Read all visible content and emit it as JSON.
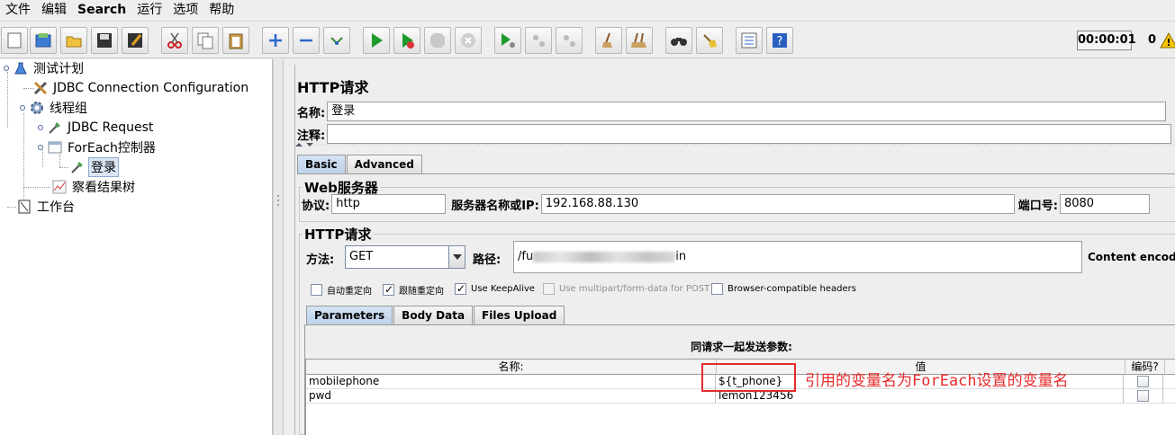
{
  "menu": [
    "文件",
    "编辑",
    "Search",
    "运行",
    "选项",
    "帮助"
  ],
  "toolbar": {
    "icons": [
      "new-icon",
      "templates-icon",
      "open-icon",
      "save-icon",
      "save-as-icon",
      "cut-icon",
      "copy-icon",
      "paste-icon",
      "expand-icon",
      "collapse-icon",
      "toggle-icon",
      "start-icon",
      "start-no-pause-icon",
      "stop-icon",
      "shutdown-icon",
      "remote-start-icon",
      "remote-stop-icon",
      "remote-shutdown-icon",
      "clear-icon",
      "clear-all-icon",
      "search-icon",
      "reset-search-icon",
      "function-helper-icon",
      "help-icon"
    ],
    "timer": "00:00:01",
    "error_count": "0"
  },
  "tree": {
    "items": [
      {
        "label": "测试计划"
      },
      {
        "label": "JDBC Connection Configuration"
      },
      {
        "label": "线程组"
      },
      {
        "label": "JDBC Request"
      },
      {
        "label": "ForEach控制器"
      },
      {
        "label": "登录"
      },
      {
        "label": "察看结果树"
      },
      {
        "label": "工作台"
      }
    ]
  },
  "panel": {
    "title": "HTTP请求",
    "name_label": "名称:",
    "name_value": "登录",
    "comment_label": "注释:",
    "comment_value": "",
    "tabs": [
      "Basic",
      "Advanced"
    ],
    "web_server": {
      "title": "Web服务器",
      "protocol_label": "协议:",
      "protocol": "http",
      "server_label": "服务器名称或IP:",
      "server": "192.168.88.130",
      "port_label": "端口号:",
      "port": "8080"
    },
    "http_request": {
      "title": "HTTP请求",
      "method_label": "方法:",
      "method": "GET",
      "path_label": "路径:",
      "path_prefix": "/fu",
      "path_suffix": "in",
      "content_encoding_label": "Content encoding"
    },
    "options": [
      {
        "label": "自动重定向",
        "checked": false,
        "disabled": false
      },
      {
        "label": "跟随重定向",
        "checked": true,
        "disabled": false
      },
      {
        "label": "Use KeepAlive",
        "checked": true,
        "disabled": false
      },
      {
        "label": "Use multipart/form-data for POST",
        "checked": false,
        "disabled": true
      },
      {
        "label": "Browser-compatible headers",
        "checked": false,
        "disabled": false
      }
    ],
    "param_tabs": [
      "Parameters",
      "Body Data",
      "Files Upload"
    ],
    "params_caption": "同请求一起发送参数:",
    "columns": [
      "名称:",
      "值",
      "编码?"
    ],
    "rows": [
      {
        "name": "mobilephone",
        "value": "${t_phone}",
        "encode": false
      },
      {
        "name": "pwd",
        "value": "lemon123456",
        "encode": false
      }
    ]
  },
  "annotation": "引用的变量名为ForEach设置的变量名"
}
